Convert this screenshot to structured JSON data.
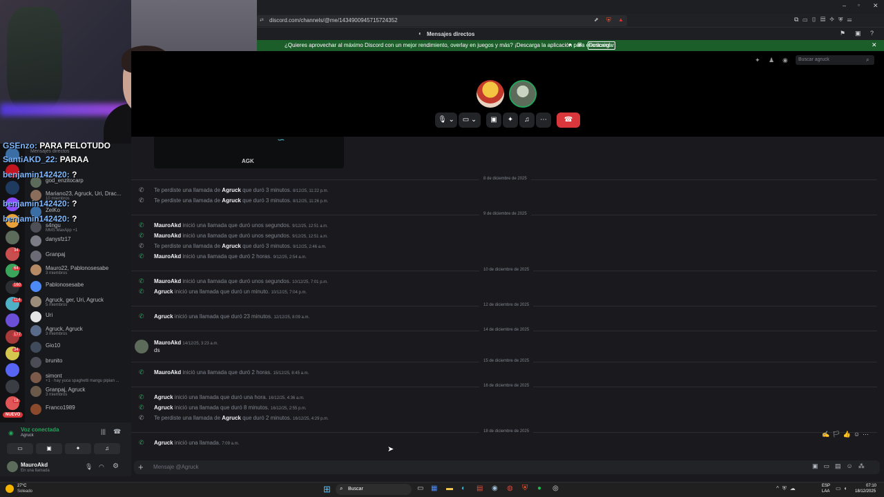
{
  "webcam_overlay": {
    "chat_lines": [
      {
        "name": "GSEnzo:",
        "text": "PARA PELOTUDO"
      },
      {
        "name": "SantiAKD_22:",
        "text": "PARAA"
      },
      {
        "name": "benjamin142420:",
        "text": "?"
      },
      {
        "name": "benjamin142420:",
        "text": "?"
      },
      {
        "name": "benjamin142420:",
        "text": "?"
      }
    ]
  },
  "browser": {
    "url": "discord.com/channels/@me/1434900945715724352",
    "tab_title": "Mensajes directos"
  },
  "banner": {
    "text": "¿Quieres aprovechar al máximo Discord con un mejor rendimiento, overlay en juegos y más? ¡Descarga la aplicación para escritorio!",
    "button": "Descargar"
  },
  "header": {
    "search_placeholder": "Buscar agruck"
  },
  "sidebar": {
    "header_label": "Mensajes directos",
    "dms": [
      {
        "name": "god_enzitocarp",
        "sub": ""
      },
      {
        "name": "Mariano23, Agruck, Uri, Drac...",
        "sub": "10 miembros"
      },
      {
        "name": "ZeiKo",
        "sub": ""
      },
      {
        "name": "s4ngu",
        "sub": "MMS MaxApp +1"
      },
      {
        "name": "danysfz17",
        "sub": ""
      },
      {
        "name": "Granpaj",
        "sub": ""
      },
      {
        "name": "Mauro22, Pablonosesabe",
        "sub": "3 miembros"
      },
      {
        "name": "Pablonosesabe",
        "sub": ""
      },
      {
        "name": "Agruck, ger, Uri, Agruck",
        "sub": "5 miembros"
      },
      {
        "name": "Uri",
        "sub": ""
      },
      {
        "name": "Agruck, Agruck",
        "sub": "3 miembros"
      },
      {
        "name": "Gio10",
        "sub": ""
      },
      {
        "name": "brunito",
        "sub": ""
      },
      {
        "name": "simont",
        "sub": "+1 · hay yuca spaghetti mangu pipian ..."
      },
      {
        "name": "Granpaj, Agruck",
        "sub": "3 miembros"
      },
      {
        "name": "Franco1989",
        "sub": ""
      }
    ],
    "server_badges": [
      "34",
      "64",
      "160",
      "114",
      "177",
      "34",
      "18"
    ],
    "nuevo_badge": "NUEVO"
  },
  "voice": {
    "status": "Voz conectada",
    "channel": "Agruck"
  },
  "user": {
    "name": "MauroAkd",
    "status": "En una llamada"
  },
  "chat": {
    "embed_label": "AGK",
    "entries": [
      {
        "type": "date",
        "text": "8 de diciembre de 2025"
      },
      {
        "type": "missed",
        "prefix": "Te perdiste una llamada de",
        "name": "Agruck",
        "suffix": "que duró 3 minutos.",
        "ts": "8/12/25, 11:22 p.m."
      },
      {
        "type": "missed",
        "prefix": "Te perdiste una llamada de",
        "name": "Agruck",
        "suffix": "que duró 3 minutos.",
        "ts": "8/12/25, 11:26 p.m."
      },
      {
        "type": "date",
        "text": "9 de diciembre de 2025"
      },
      {
        "type": "call",
        "name": "MauroAkd",
        "suffix": "inició una llamada que duró unos segundos.",
        "ts": "9/12/25, 12:51 a.m."
      },
      {
        "type": "call",
        "name": "MauroAkd",
        "suffix": "inició una llamada que duró unos segundos.",
        "ts": "9/12/25, 12:51 a.m."
      },
      {
        "type": "missed",
        "prefix": "Te perdiste una llamada de",
        "name": "Agruck",
        "suffix": "que duró 3 minutos.",
        "ts": "9/12/25, 2:46 a.m."
      },
      {
        "type": "call",
        "name": "MauroAkd",
        "suffix": "inició una llamada que duró 2 horas.",
        "ts": "9/12/25, 2:54 a.m."
      },
      {
        "type": "date",
        "text": "10 de diciembre de 2025"
      },
      {
        "type": "call",
        "name": "MauroAkd",
        "suffix": "inició una llamada que duró unos segundos.",
        "ts": "10/12/25, 7:01 p.m."
      },
      {
        "type": "call",
        "name": "Agruck",
        "suffix": "inició una llamada que duró un minuto.",
        "ts": "10/12/25, 7:04 p.m."
      },
      {
        "type": "date",
        "text": "12 de diciembre de 2025"
      },
      {
        "type": "call",
        "name": "Agruck",
        "suffix": "inició una llamada que duró 23 minutos.",
        "ts": "12/12/25, 8:09 a.m."
      },
      {
        "type": "date",
        "text": "14 de diciembre de 2025"
      },
      {
        "type": "message",
        "name": "MauroAkd",
        "ts": "14/12/25, 3:23 a.m.",
        "text": "ds"
      },
      {
        "type": "date",
        "text": "15 de diciembre de 2025"
      },
      {
        "type": "call",
        "name": "MauroAkd",
        "suffix": "inició una llamada que duró 2 horas.",
        "ts": "15/12/25, 8:45 a.m."
      },
      {
        "type": "date",
        "text": "16 de diciembre de 2025"
      },
      {
        "type": "call",
        "name": "Agruck",
        "suffix": "inició una llamada que duró una hora.",
        "ts": "16/12/25, 4:36 a.m."
      },
      {
        "type": "call",
        "name": "Agruck",
        "suffix": "inició una llamada que duró 8 minutos.",
        "ts": "16/12/25, 2:55 p.m."
      },
      {
        "type": "missed",
        "prefix": "Te perdiste una llamada de",
        "name": "Agruck",
        "suffix": "que duró 2 minutos.",
        "ts": "16/12/25, 4:29 p.m."
      },
      {
        "type": "date",
        "text": "18 de diciembre de 2025"
      },
      {
        "type": "call",
        "name": "Agruck",
        "suffix": "inició una llamada.",
        "ts": "7:09 a.m."
      }
    ],
    "composer_placeholder": "Mensaje @Agruck"
  },
  "taskbar": {
    "weather_temp": "27°C",
    "weather_desc": "Soleado",
    "search_label": "Buscar",
    "lang": "ESP",
    "lang2": "LAA",
    "time": "07:10",
    "date": "18/12/2025"
  },
  "colors": {
    "accent_green": "#23a55a",
    "danger_red": "#da373c",
    "banner_green": "#1b5e2a"
  }
}
